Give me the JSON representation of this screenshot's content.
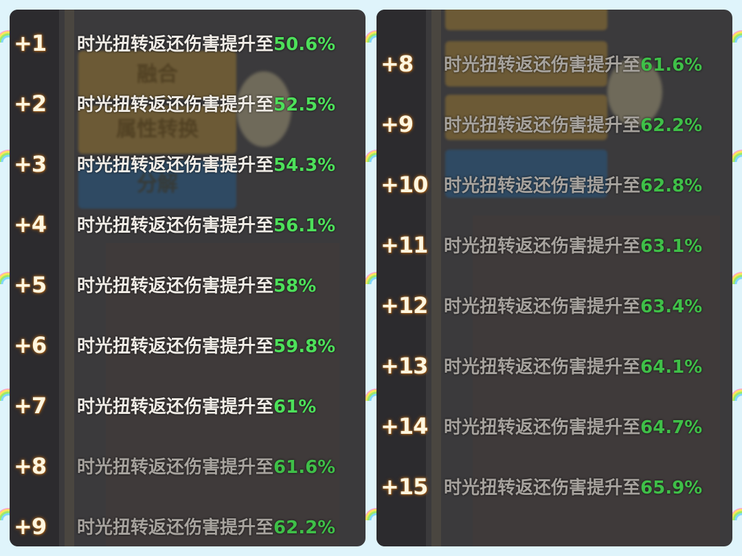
{
  "background_labels": {
    "fuse": "融合",
    "attribute_convert": "属性转换",
    "decompose": "分解"
  },
  "rows_left": [
    {
      "level": "+1",
      "text": "时光扭转返还伤害提升至",
      "value": "50.6%"
    },
    {
      "level": "+2",
      "text": "时光扭转返还伤害提升至",
      "value": "52.5%"
    },
    {
      "level": "+3",
      "text": "时光扭转返还伤害提升至",
      "value": "54.3%"
    },
    {
      "level": "+4",
      "text": "时光扭转返还伤害提升至",
      "value": "56.1%"
    },
    {
      "level": "+5",
      "text": "时光扭转返还伤害提升至",
      "value": "58%"
    },
    {
      "level": "+6",
      "text": "时光扭转返还伤害提升至",
      "value": "59.8%"
    },
    {
      "level": "+7",
      "text": "时光扭转返还伤害提升至",
      "value": "61%"
    },
    {
      "level": "+8",
      "text": "时光扭转返还伤害提升至",
      "value": "61.6%"
    },
    {
      "level": "+9",
      "text": "时光扭转返还伤害提升至",
      "value": "62.2%"
    }
  ],
  "rows_right": [
    {
      "level": "+8",
      "text": "时光扭转返还伤害提升至",
      "value": "61.6%"
    },
    {
      "level": "+9",
      "text": "时光扭转返还伤害提升至",
      "value": "62.2%"
    },
    {
      "level": "+10",
      "text": "时光扭转返还伤害提升至",
      "value": "62.8%"
    },
    {
      "level": "+11",
      "text": "时光扭转返还伤害提升至",
      "value": "63.1%"
    },
    {
      "level": "+12",
      "text": "时光扭转返还伤害提升至",
      "value": "63.4%"
    },
    {
      "level": "+13",
      "text": "时光扭转返还伤害提升至",
      "value": "64.1%"
    },
    {
      "level": "+14",
      "text": "时光扭转返还伤害提升至",
      "value": "64.7%"
    },
    {
      "level": "+15",
      "text": "时光扭转返还伤害提升至",
      "value": "65.9%"
    }
  ],
  "colors": {
    "value_green": "#4de05a",
    "level_gold": "#fff6df",
    "panel_bg": "#3b3a3c",
    "page_bg": "#dff4fb"
  }
}
